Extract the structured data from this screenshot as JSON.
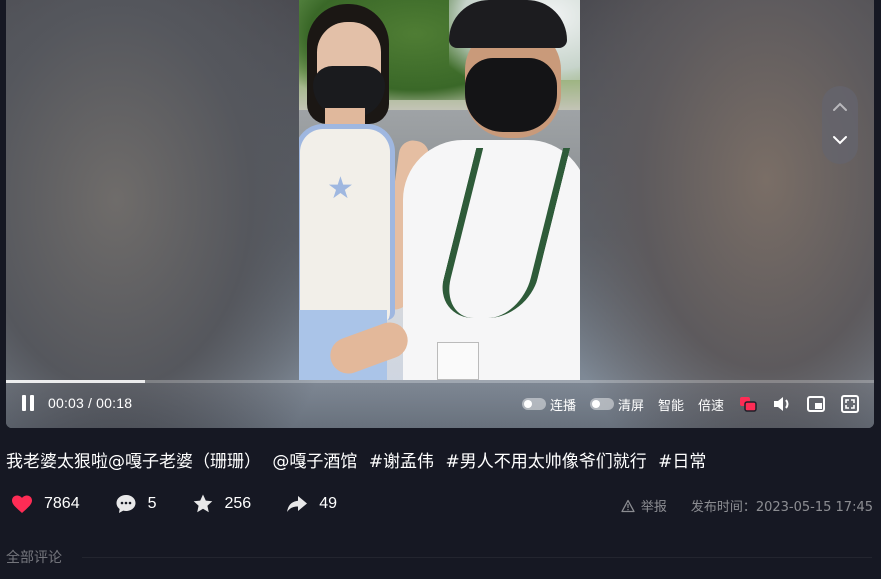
{
  "player": {
    "time_current": "00:03",
    "time_separator": "/",
    "time_total": "00:18",
    "progress": 0.16,
    "controls": {
      "autoplay_label": "连播",
      "clear_screen_label": "清屏",
      "smart_label": "智能",
      "speed_label": "倍速"
    }
  },
  "video": {
    "title_parts": [
      "我老婆太狠啦@嘎子老婆（珊珊）",
      "@嘎子酒馆",
      "#谢孟伟",
      "#男人不用太帅像爷们就行",
      "#日常"
    ]
  },
  "stats": {
    "likes": "7864",
    "comments": "5",
    "favorites": "256",
    "shares": "49"
  },
  "meta": {
    "report_label": "举报",
    "publish_time": "发布时间：2023-05-15 17:45"
  },
  "comments": {
    "header": "全部评论"
  },
  "colors": {
    "background": "#161823",
    "like": "#fe2c55",
    "danmaku_active": "#fe2c55"
  },
  "icons": {
    "like": "heart-icon",
    "comment": "chat-bubble-icon",
    "favorite": "star-icon",
    "share": "share-arrow-icon"
  }
}
